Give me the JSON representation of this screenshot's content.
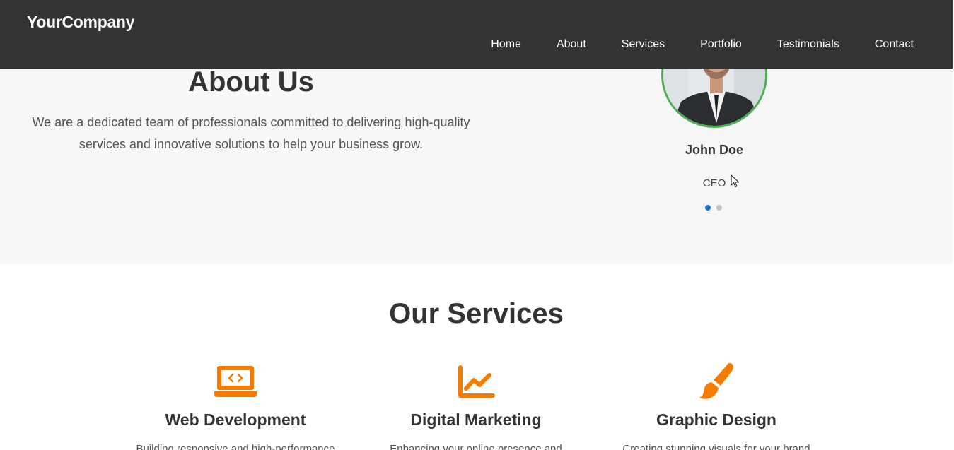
{
  "header": {
    "logo": "YourCompany",
    "nav": [
      "Home",
      "About",
      "Services",
      "Portfolio",
      "Testimonials",
      "Contact"
    ]
  },
  "about": {
    "title": "About Us",
    "text": "We are a dedicated team of professionals committed to delivering high-quality services and innovative solutions to help your business grow."
  },
  "team": {
    "member": {
      "name": "John Doe",
      "role": "CEO"
    },
    "slides": 2,
    "active_slide": 1
  },
  "services": {
    "title": "Our Services",
    "items": [
      {
        "icon": "laptop-code-icon",
        "title": "Web Development",
        "text": "Building responsive and high-performance"
      },
      {
        "icon": "chart-line-icon",
        "title": "Digital Marketing",
        "text": "Enhancing your online presence and"
      },
      {
        "icon": "paint-brush-icon",
        "title": "Graphic Design",
        "text": "Creating stunning visuals for your brand"
      }
    ]
  },
  "colors": {
    "header_bg": "#333333",
    "about_bg": "#f7f7f7",
    "accent_orange": "#f57c00",
    "avatar_border": "#4caf50",
    "dot_active": "#1a73e8",
    "dot_inactive": "#c4c4c4"
  }
}
